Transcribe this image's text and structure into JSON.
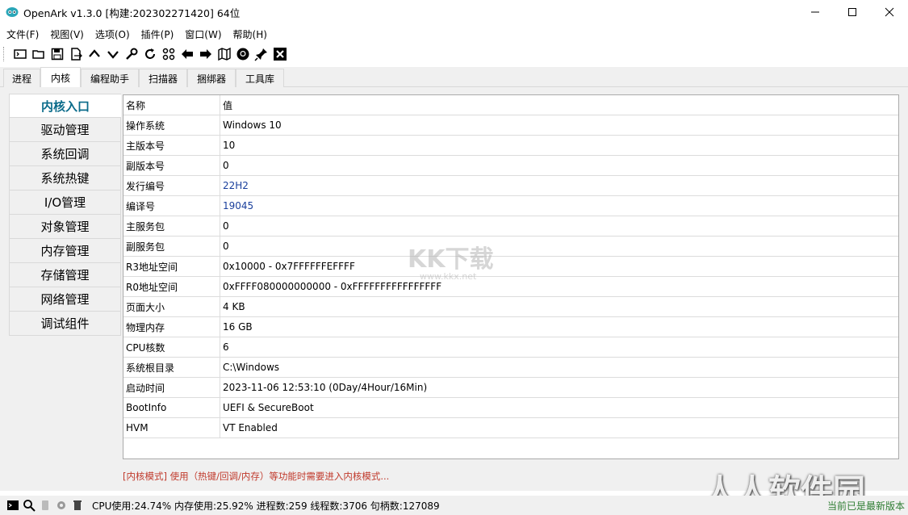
{
  "window": {
    "title": "OpenArk v1.3.0 [构建:202302271420]  64位"
  },
  "menu": [
    "文件(F)",
    "视图(V)",
    "选项(O)",
    "插件(P)",
    "窗口(W)",
    "帮助(H)"
  ],
  "tabs": [
    "进程",
    "内核",
    "编程助手",
    "扫描器",
    "捆绑器",
    "工具库"
  ],
  "sidebar": [
    "内核入口",
    "驱动管理",
    "系统回调",
    "系统热键",
    "I/O管理",
    "对象管理",
    "内存管理",
    "存储管理",
    "网络管理",
    "调试组件"
  ],
  "grid": {
    "header": {
      "key": "名称",
      "value": "值"
    },
    "rows": [
      {
        "key": "操作系统",
        "value": "Windows 10"
      },
      {
        "key": "主版本号",
        "value": "10"
      },
      {
        "key": "副版本号",
        "value": "0"
      },
      {
        "key": "发行编号",
        "value": "22H2"
      },
      {
        "key": "编译号",
        "value": "19045"
      },
      {
        "key": "主服务包",
        "value": "0"
      },
      {
        "key": "副服务包",
        "value": "0"
      },
      {
        "key": "R3地址空间",
        "value": "0x10000 - 0x7FFFFFFEFFFF"
      },
      {
        "key": "R0地址空间",
        "value": "0xFFFF080000000000 - 0xFFFFFFFFFFFFFFFF"
      },
      {
        "key": "页面大小",
        "value": "4 KB"
      },
      {
        "key": "物理内存",
        "value": "16 GB"
      },
      {
        "key": "CPU核数",
        "value": "6"
      },
      {
        "key": "系统根目录",
        "value": "C:\\Windows"
      },
      {
        "key": "启动时间",
        "value": "2023-11-06 12:53:10 (0Day/4Hour/16Min)"
      },
      {
        "key": "BootInfo",
        "value": "UEFI & SecureBoot"
      },
      {
        "key": "HVM",
        "value": "VT Enabled"
      }
    ]
  },
  "notice": "[内核模式] 使用（热键/回调/内存）等功能时需要进入内核模式...",
  "status": {
    "text": "CPU使用:24.74%  内存使用:25.92%  进程数:259  线程数:3706  句柄数:127089",
    "version": "当前已是最新版本"
  },
  "watermarks": {
    "kk": "KK下载",
    "kk_url": "www.kkx.net",
    "rr": "人人软件园"
  },
  "colors": {
    "accent": "#0a6b8a",
    "notice": "#c0392b",
    "version": "#2e7d32"
  }
}
